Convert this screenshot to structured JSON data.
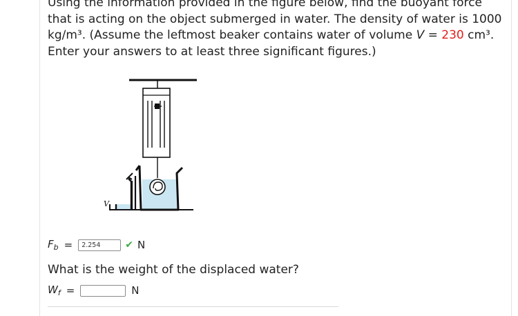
{
  "prompt": {
    "line1": "Using the information provided in the figure below, find the buoyant force",
    "line2": "that is acting on the object submerged in water. The density of water is 1000",
    "line3_a": "kg/m³. (Assume the leftmost beaker contains water of volume ",
    "line3_var": "V",
    "line3_eq": " = ",
    "line3_val": "230",
    "line3_unit": " cm³.",
    "line4": "Enter your answers to at least three significant figures.)"
  },
  "figure": {
    "beaker_label": "V",
    "water_color": "#c9e6f2"
  },
  "q1": {
    "var": "F",
    "sub": "b",
    "eq": "=",
    "value": "2.254",
    "status": "correct",
    "status_icon": "✔",
    "unit": "N"
  },
  "q2": {
    "question": "What is the weight of the displaced water?",
    "var": "W",
    "sub": "f",
    "eq": "=",
    "value": "",
    "unit": "N"
  },
  "colors": {
    "accent_red": "#e0201b",
    "check_green": "#3fa844"
  }
}
